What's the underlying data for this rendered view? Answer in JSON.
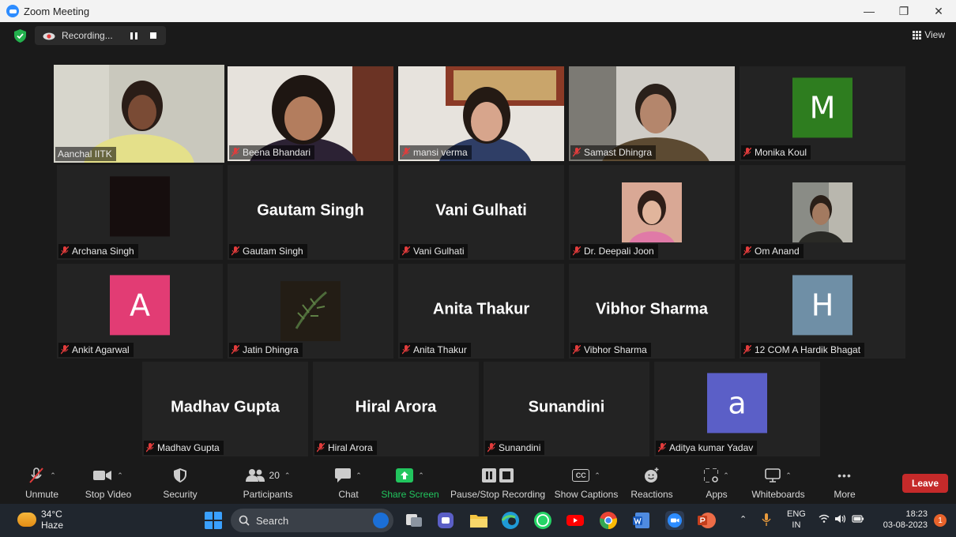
{
  "window": {
    "title": "Zoom Meeting"
  },
  "topbar": {
    "recording_label": "Recording...",
    "view_label": "View"
  },
  "participants": [
    {
      "name": "Aanchal IITK"
    },
    {
      "name": "Beena Bhandari"
    },
    {
      "name": "mansi verma"
    },
    {
      "name": "Samast Dhingra"
    },
    {
      "name": "Monika Koul",
      "avatar_letter": "M",
      "avatar_color": "#2e7d1f"
    },
    {
      "name": "Archana Singh"
    },
    {
      "name": "Gautam Singh",
      "big_name": "Gautam Singh"
    },
    {
      "name": "Vani Gulhati",
      "big_name": "Vani Gulhati"
    },
    {
      "name": "Dr. Deepali Joon"
    },
    {
      "name": "Om Anand"
    },
    {
      "name": "Ankit Agarwal",
      "avatar_letter": "A",
      "avatar_color": "#e23c74"
    },
    {
      "name": "Jatin Dhingra"
    },
    {
      "name": "Anita Thakur",
      "big_name": "Anita Thakur"
    },
    {
      "name": "Vibhor Sharma",
      "big_name": "Vibhor Sharma"
    },
    {
      "name": "12 COM A Hardik Bhagat",
      "avatar_letter": "H",
      "avatar_color": "#6f8fa6"
    },
    {
      "name": "Madhav Gupta",
      "big_name": "Madhav Gupta"
    },
    {
      "name": "Hiral Arora",
      "big_name": "Hiral Arora"
    },
    {
      "name": "Sunandini",
      "big_name": "Sunandini"
    },
    {
      "name": "Aditya kumar Yadav",
      "avatar_letter": "a",
      "avatar_color": "#5b5fc7"
    }
  ],
  "toolbar": {
    "unmute": "Unmute",
    "stop_video": "Stop Video",
    "security": "Security",
    "participants": "Participants",
    "participants_count": "20",
    "chat": "Chat",
    "share_screen": "Share Screen",
    "pause_stop_recording": "Pause/Stop Recording",
    "show_captions": "Show Captions",
    "captions_icon_text": "CC",
    "reactions": "Reactions",
    "apps": "Apps",
    "whiteboards": "Whiteboards",
    "more": "More",
    "leave": "Leave"
  },
  "taskbar": {
    "temperature": "34°C",
    "weather": "Haze",
    "search_placeholder": "Search",
    "lang_top": "ENG",
    "lang_bottom": "IN",
    "time": "18:23",
    "date": "03-08-2023",
    "notification_count": "1"
  }
}
